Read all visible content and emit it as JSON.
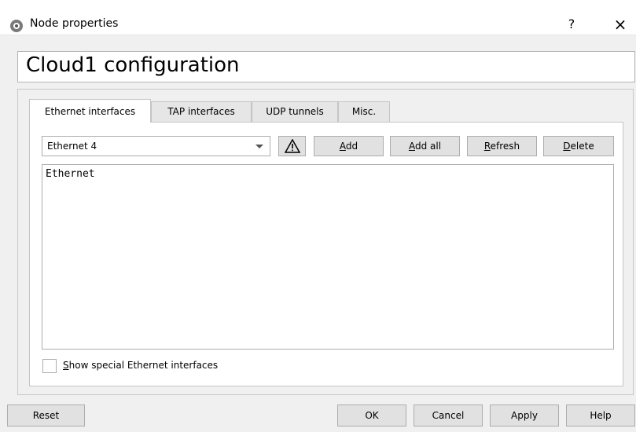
{
  "window": {
    "title": "Node properties",
    "help_label": "?",
    "close_label": "×"
  },
  "header": {
    "title": "Cloud1 configuration"
  },
  "tabs": [
    {
      "label": "Ethernet interfaces",
      "active": true
    },
    {
      "label": "TAP interfaces",
      "active": false
    },
    {
      "label": "UDP tunnels",
      "active": false
    },
    {
      "label": "Misc.",
      "active": false
    }
  ],
  "ethernet": {
    "selected_interface": "Ethernet 4",
    "warning_icon": "warning-triangle-icon",
    "buttons": {
      "add": {
        "mnemonic": "A",
        "rest": "dd"
      },
      "add_all": {
        "mnemonic": "A",
        "rest": "dd all"
      },
      "refresh": {
        "mnemonic": "R",
        "rest": "efresh"
      },
      "delete": {
        "mnemonic": "D",
        "rest": "elete"
      }
    },
    "list_items": [
      "Ethernet"
    ],
    "show_special": {
      "mnemonic": "S",
      "rest": "how special Ethernet interfaces",
      "checked": false
    }
  },
  "footer": {
    "reset": "Reset",
    "ok": "OK",
    "cancel": "Cancel",
    "apply": "Apply",
    "help": "Help"
  }
}
